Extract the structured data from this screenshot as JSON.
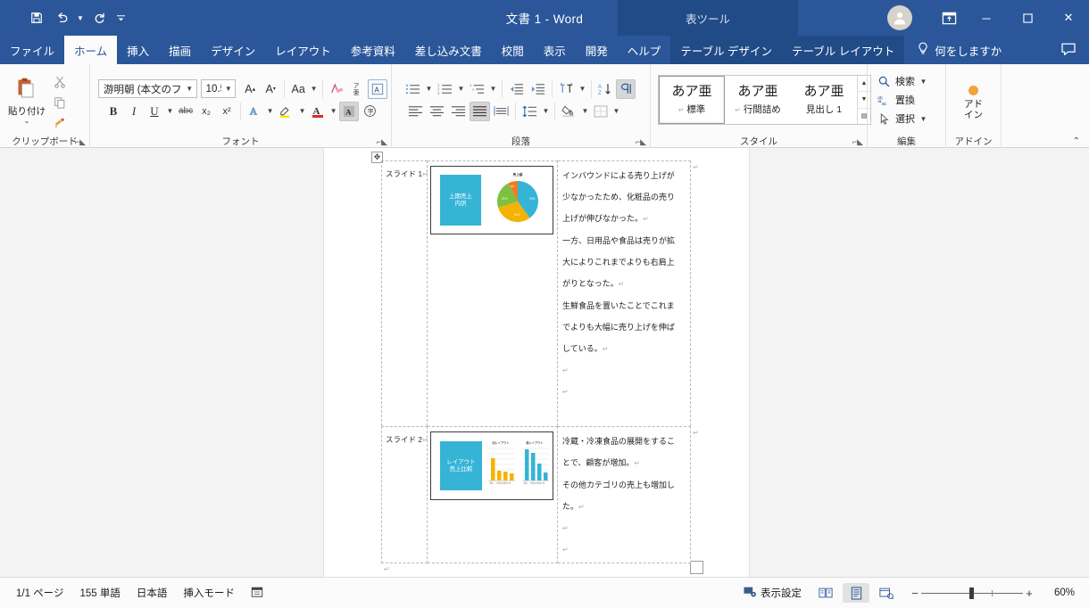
{
  "window": {
    "title": "文書 1  -  Word",
    "contextual_group": "表ツール",
    "quick_access": [
      {
        "name": "save",
        "glyph": "ὋE"
      },
      {
        "name": "undo",
        "glyph": "↶"
      },
      {
        "name": "redo",
        "glyph": "↻"
      },
      {
        "name": "customize",
        "glyph": "▾"
      }
    ],
    "buttons": {
      "minimize": "─",
      "maximize": "☐",
      "close": "✕"
    }
  },
  "tabs": [
    {
      "label": "ファイル",
      "active": false
    },
    {
      "label": "ホーム",
      "active": true
    },
    {
      "label": "挿入",
      "active": false
    },
    {
      "label": "描画",
      "active": false
    },
    {
      "label": "デザイン",
      "active": false
    },
    {
      "label": "レイアウト",
      "active": false
    },
    {
      "label": "参考資料",
      "active": false
    },
    {
      "label": "差し込み文書",
      "active": false
    },
    {
      "label": "校閲",
      "active": false
    },
    {
      "label": "表示",
      "active": false
    },
    {
      "label": "開発",
      "active": false
    },
    {
      "label": "ヘルプ",
      "active": false
    }
  ],
  "contextual_tabs": [
    {
      "label": "テーブル デザイン"
    },
    {
      "label": "テーブル レイアウト"
    }
  ],
  "tell_me": {
    "label": "何をしますか",
    "icon": "lightbulb-icon"
  },
  "ribbon": {
    "clipboard": {
      "group_label": "クリップボード",
      "paste_label": "貼り付け",
      "cut_label": "切り取り",
      "copy_label": "コピー",
      "format_painter_label": "書式のコピー／貼り付け"
    },
    "font": {
      "group_label": "フォント",
      "font_name": "游明朝 (本文のフォン",
      "font_size": "10.5",
      "buttons": [
        "A↑",
        "A↓",
        "Aa",
        "ルビ",
        "囲い文字",
        "文字種"
      ],
      "bold": "B",
      "italic": "I",
      "underline": "U",
      "strikethrough": "abc",
      "subscript": "x₂",
      "superscript": "x²"
    },
    "paragraph": {
      "group_label": "段落",
      "show_marks_on": true,
      "align_justify_on": true
    },
    "styles": {
      "group_label": "スタイル",
      "items": [
        {
          "sample": "あア亜",
          "name": "標準",
          "selected": true
        },
        {
          "sample": "あア亜",
          "name": "行間詰め",
          "selected": false
        },
        {
          "sample": "あア亜",
          "name": "見出し 1",
          "selected": false
        }
      ]
    },
    "editing": {
      "group_label": "編集",
      "items": [
        {
          "label": "検索",
          "icon": "search-icon",
          "has_caret": true
        },
        {
          "label": "置換",
          "icon": "replace-icon",
          "has_caret": false
        },
        {
          "label": "選択",
          "icon": "select-icon",
          "has_caret": true
        }
      ]
    },
    "addins": {
      "group_label": "アドイン",
      "button_line1": "アド",
      "button_line2": "イン"
    },
    "collapse_icon": "chevron-up-icon"
  },
  "document": {
    "table": {
      "rows": [
        {
          "label": "スライド 1",
          "slide": {
            "title_line1": "上期売上",
            "title_line2": "内訳",
            "chart": {
              "type": "pie",
              "title": "売上額"
            }
          },
          "text_lines": [
            "インバウンドによる売り上げが",
            "少なかったため、化粧品の売り",
            "上げが伸びなかった。",
            "一方、日用品や食品は売りが拡",
            "大によりこれまでよりも右肩上",
            "がりとなった。",
            "生鮮食品を置いたことでこれま",
            "でよりも大幅に売り上げを伸ば",
            "している。"
          ]
        },
        {
          "label": "スライド 2",
          "slide": {
            "title_line1": "レイアウト",
            "title_line2": "売上比較",
            "chart": {
              "type": "bar",
              "title_left": "旧レイアウト",
              "title_right": "新レイアウト"
            }
          },
          "text_lines": [
            "冷蔵・冷凍食品の展開をするこ",
            "とで、顧客が増加。",
            "その他カテゴリの売上も増加し",
            "た。"
          ]
        }
      ]
    }
  },
  "chart_data": [
    {
      "type": "pie",
      "title": "売上額",
      "categories": [
        "食品",
        "日用品",
        "化粧品",
        "その他"
      ],
      "values": [
        40,
        31,
        21,
        8
      ],
      "colors": [
        "#35b4d6",
        "#f5b200",
        "#7cc142",
        "#f07c1e"
      ],
      "legend": "none"
    },
    {
      "type": "bar",
      "title": "旧レイアウト",
      "categories": [
        "食品",
        "日用品",
        "化粧品",
        "その他"
      ],
      "values": [
        62,
        27,
        25,
        20
      ],
      "colors": [
        "#f5b200"
      ],
      "ylim": [
        0,
        100
      ],
      "grid": true
    },
    {
      "type": "bar",
      "title": "新レイアウト",
      "categories": [
        "食品",
        "日用品",
        "化粧品",
        "その他"
      ],
      "values": [
        88,
        76,
        47,
        22
      ],
      "colors": [
        "#35b4d6"
      ],
      "ylim": [
        0,
        100
      ],
      "grid": true
    }
  ],
  "status": {
    "page": "1/1 ページ",
    "words": "155 単語",
    "language": "日本語",
    "mode": "挿入モード",
    "accessibility_icon": "accessibility-icon",
    "display_settings": "表示設定",
    "views": [
      {
        "name": "read-mode",
        "icon": "book-icon",
        "active": false
      },
      {
        "name": "print-layout",
        "icon": "page-icon",
        "active": true
      },
      {
        "name": "web-layout",
        "icon": "web-icon",
        "active": false
      }
    ],
    "zoom_out": "−",
    "zoom_in": "+",
    "zoom_level": "60%"
  },
  "colors": {
    "brand": "#2b579a",
    "contextual": "#204b87",
    "accent_cyan": "#35b4d6",
    "accent_yellow": "#f5b200",
    "accent_green": "#7cc142",
    "accent_orange": "#f07c1e"
  }
}
